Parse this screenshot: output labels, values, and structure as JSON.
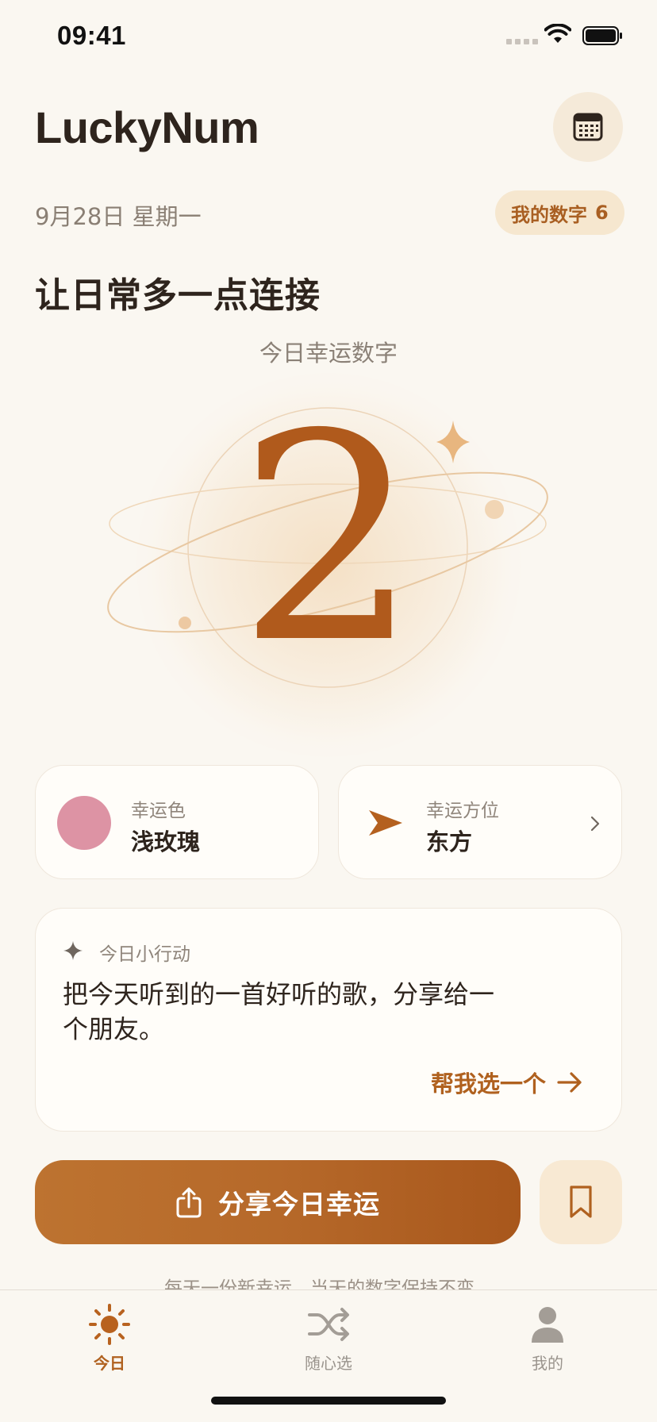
{
  "status_bar": {
    "time": "09:41"
  },
  "header": {
    "app_title": "LuckyNum",
    "date": "9月28日 星期一",
    "my_number_label": "我的数字",
    "my_number_value": "6",
    "slogan": "让日常多一点连接"
  },
  "hero": {
    "label": "今日幸运数字",
    "number": "2"
  },
  "lucky_color": {
    "label": "幸运色",
    "value": "浅玫瑰",
    "swatch_color": "#dd93a4"
  },
  "lucky_direction": {
    "label": "幸运方位",
    "value": "东方"
  },
  "daily_action": {
    "label": "今日小行动",
    "text": "把今天听到的一首好听的歌，分享给一个朋友。",
    "pick_label": "帮我选一个"
  },
  "share": {
    "label": "分享今日幸运"
  },
  "footnote": "每天一份新幸运，当天的数字保持不变。",
  "tabs": [
    {
      "label": "今日",
      "icon": "sun-icon",
      "active": true
    },
    {
      "label": "随心选",
      "icon": "shuffle-icon",
      "active": false
    },
    {
      "label": "我的",
      "icon": "person-icon",
      "active": false
    }
  ],
  "colors": {
    "accent": "#b0611f",
    "background": "#faf7f1",
    "number": "#b05a1c"
  }
}
